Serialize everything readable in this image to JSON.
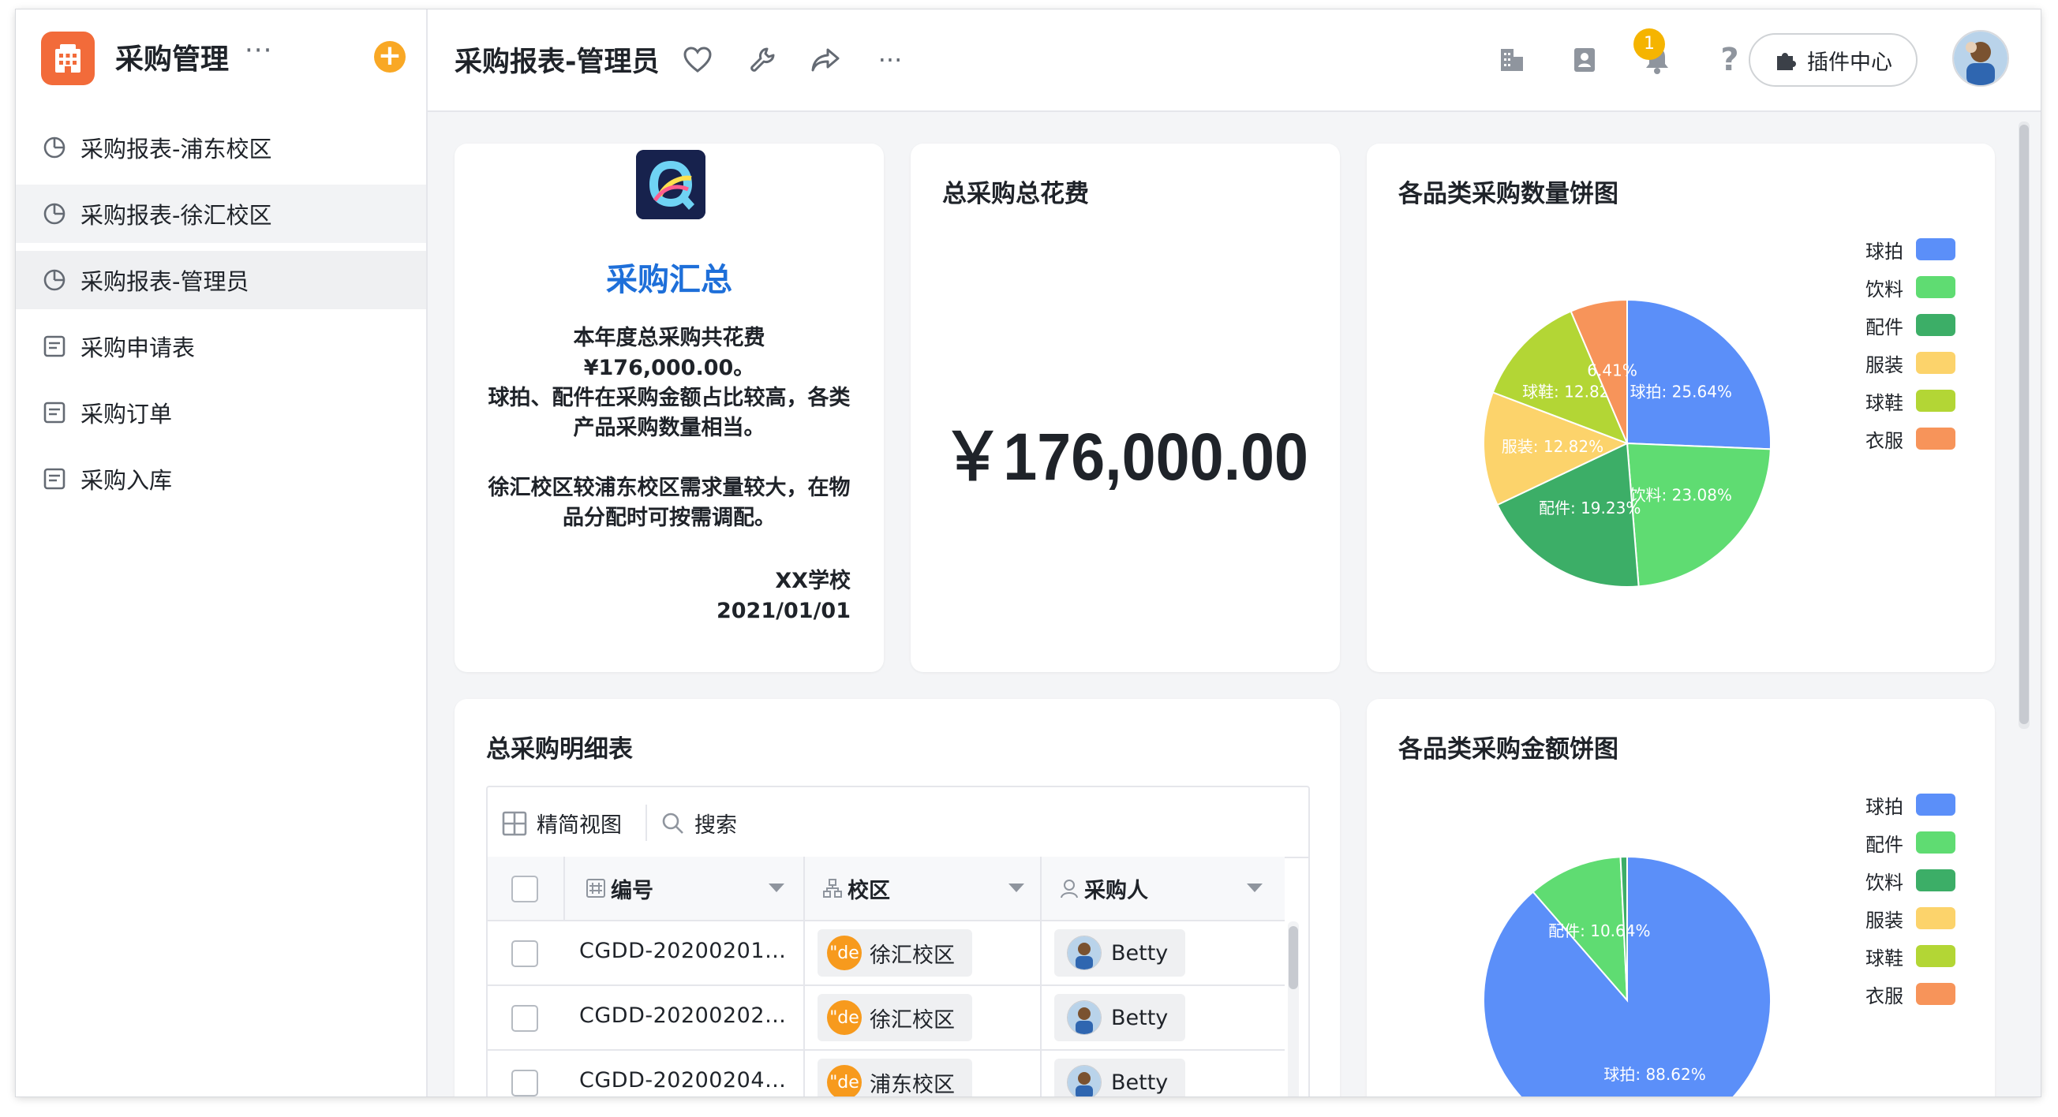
{
  "app": {
    "title": "采购管理",
    "more": "···",
    "add": "+"
  },
  "sidebar": {
    "items": [
      {
        "label": "采购报表-浦东校区",
        "icon": "chart-icon"
      },
      {
        "label": "采购报表-徐汇校区",
        "icon": "chart-icon"
      },
      {
        "label": "采购报表-管理员",
        "icon": "chart-icon"
      },
      {
        "label": "采购申请表",
        "icon": "form-icon"
      },
      {
        "label": "采购订单",
        "icon": "form-icon"
      },
      {
        "label": "采购入库",
        "icon": "form-icon"
      }
    ]
  },
  "header": {
    "title": "采购报表-管理员",
    "notification_count": "1",
    "plugin_label": "插件中心",
    "more": "···"
  },
  "summary": {
    "title": "采购汇总",
    "paragraph1": "本年度总采购共花费\n¥176,000.00。\n球拍、配件在采购金额占比较高，各类产品采购数量相当。",
    "paragraph2": "徐汇校区较浦东校区需求量较大，在物品分配时可按需调配。",
    "signature": "XX学校",
    "date": "2021/01/01"
  },
  "total": {
    "title": "总采购总花费",
    "value": "￥176,000.00"
  },
  "pie_qty": {
    "title": "各品类采购数量饼图"
  },
  "pie_amount": {
    "title": "各品类采购金额饼图"
  },
  "table": {
    "title": "总采购明细表",
    "view_label": "精简视图",
    "search_label": "搜索",
    "columns": [
      "编号",
      "校区",
      "采购人"
    ],
    "rows": [
      {
        "id": "CGDD-20200201…",
        "campus": "徐汇校区",
        "buyer": "Betty"
      },
      {
        "id": "CGDD-20200202…",
        "campus": "徐汇校区",
        "buyer": "Betty"
      },
      {
        "id": "CGDD-20200204…",
        "campus": "浦东校区",
        "buyer": "Betty"
      }
    ],
    "chip_glyph": "\"de"
  },
  "colors": {
    "accent_blue": "#1e6fd9",
    "orange": "#f26b3a",
    "badge": "#f5b400"
  },
  "chart_data": [
    {
      "type": "pie",
      "title": "各品类采购数量饼图",
      "legend": [
        "球拍",
        "饮料",
        "配件",
        "服装",
        "球鞋",
        "衣服"
      ],
      "legend_colors": [
        "#5b8ff9",
        "#5fdc72",
        "#3cae67",
        "#fcd36b",
        "#b3d635",
        "#f7945a"
      ],
      "slices": [
        {
          "label": "球拍",
          "value": 25.64,
          "text": "球拍: 25.64%",
          "color": "#5b8ff9"
        },
        {
          "label": "饮料",
          "value": 23.08,
          "text": "饮料: 23.08%",
          "color": "#5fdc72"
        },
        {
          "label": "配件",
          "value": 19.23,
          "text": "配件: 19.23%",
          "color": "#3cae67"
        },
        {
          "label": "服装",
          "value": 12.82,
          "text": "服装: 12.82%",
          "color": "#fcd36b"
        },
        {
          "label": "球鞋",
          "value": 12.82,
          "text": "球鞋: 12.82%",
          "color": "#b3d635"
        },
        {
          "label": "衣服",
          "value": 6.41,
          "text": "6.41%",
          "color": "#f7945a"
        }
      ],
      "legend_position": "right"
    },
    {
      "type": "pie",
      "title": "各品类采购金额饼图",
      "legend": [
        "球拍",
        "配件",
        "饮料",
        "服装",
        "球鞋",
        "衣服"
      ],
      "legend_colors": [
        "#5b8ff9",
        "#5fdc72",
        "#3cae67",
        "#fcd36b",
        "#b3d635",
        "#f7945a"
      ],
      "slices": [
        {
          "label": "球拍",
          "value": 88.62,
          "text": "球拍: 88.62%",
          "color": "#5b8ff9"
        },
        {
          "label": "配件",
          "value": 10.64,
          "text": "配件: 10.64%",
          "color": "#5fdc72"
        },
        {
          "label": "饮料",
          "value": 0.74,
          "text": "",
          "color": "#3cae67"
        }
      ],
      "legend_position": "right"
    }
  ]
}
